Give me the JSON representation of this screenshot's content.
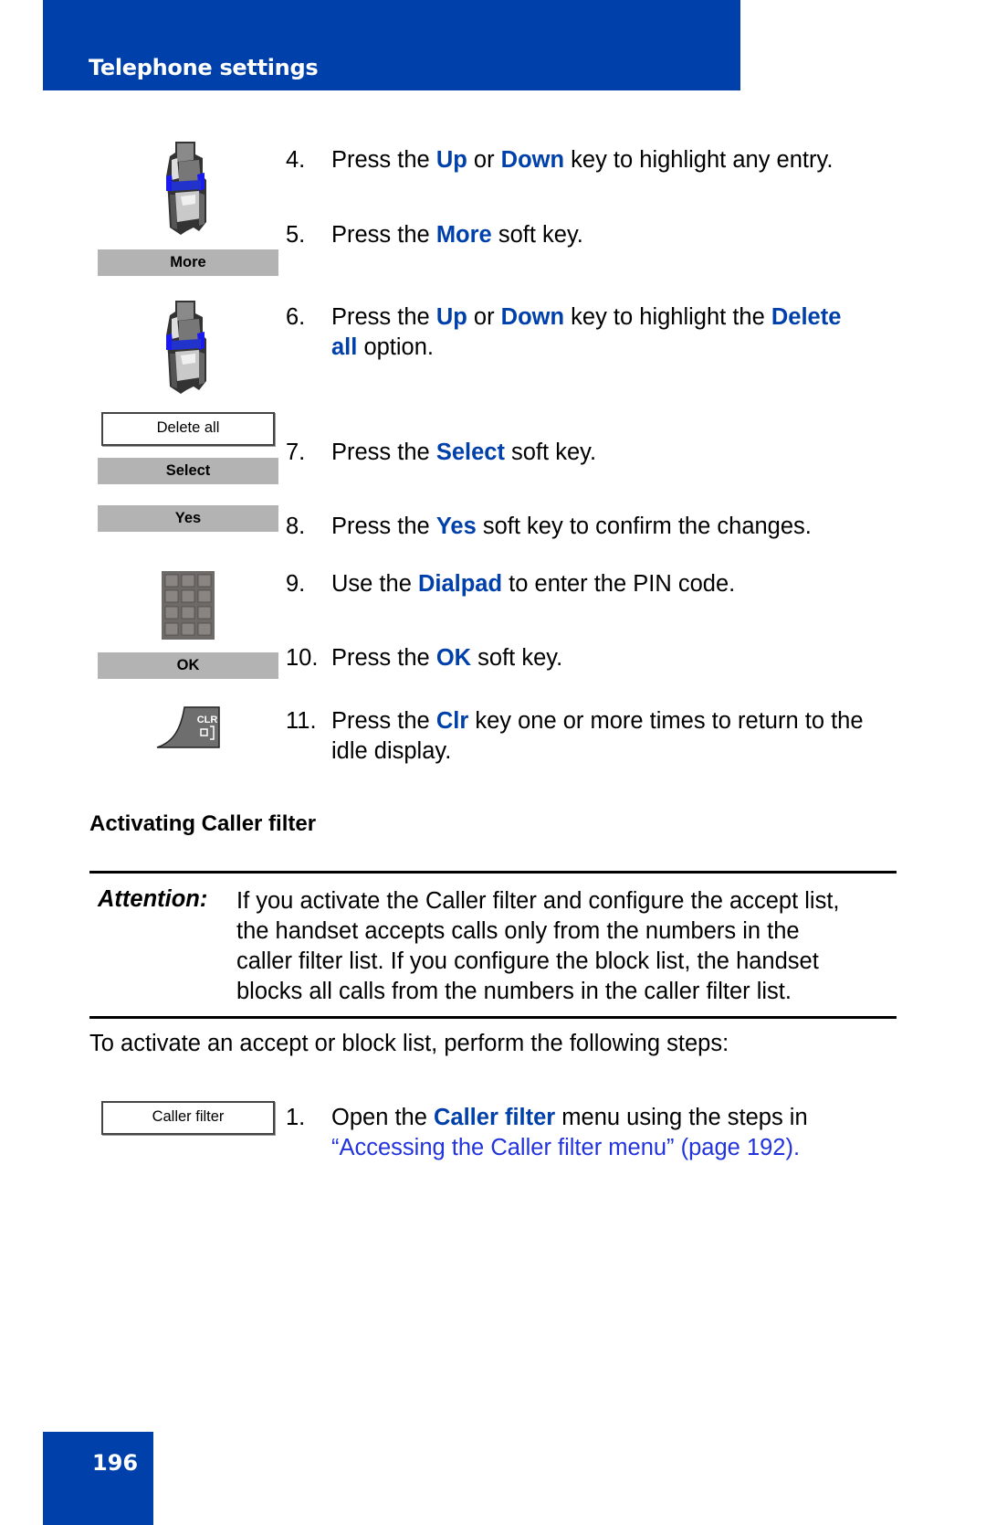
{
  "header": {
    "title": "Telephone settings"
  },
  "footer": {
    "page_number": "196"
  },
  "softkeys": {
    "more": "More",
    "delete_all": "Delete all",
    "select": "Select",
    "yes": "Yes",
    "ok": "OK",
    "caller_filter": "Caller filter"
  },
  "icons": {
    "navigation_key": "navigation-key-icon",
    "dialpad": "dialpad-icon",
    "clear_key": "clr-key-icon",
    "clear_key_label": "CLR"
  },
  "colors": {
    "brand_blue": "#0040AA",
    "softkey_gray": "#B3B3B3",
    "link_blue": "#2233DD"
  },
  "steps_part1": [
    {
      "num": "4.",
      "parts": [
        "Press the ",
        "Up",
        " or ",
        "Down",
        " key to highlight any entry."
      ]
    },
    {
      "num": "5.",
      "parts": [
        "Press the ",
        "More",
        " soft key."
      ]
    },
    {
      "num": "6.",
      "line1": [
        "Press the ",
        "Up",
        " or ",
        "Down",
        " key to highlight the ",
        "Delete"
      ],
      "line2": [
        "all",
        " option."
      ]
    },
    {
      "num": "7.",
      "parts": [
        "Press the ",
        "Select",
        " soft key."
      ]
    },
    {
      "num": "8.",
      "parts": [
        "Press the ",
        "Yes",
        " soft key to confirm the changes."
      ]
    },
    {
      "num": "9.",
      "parts": [
        "Use the ",
        "Dialpad",
        " to enter the PIN code."
      ]
    },
    {
      "num": "10.",
      "parts": [
        "Press the ",
        "OK",
        " soft key."
      ]
    },
    {
      "num": "11.",
      "line1": [
        "Press the ",
        "Clr",
        " key one or more times to return to the"
      ],
      "line2": [
        "idle display."
      ]
    }
  ],
  "section": {
    "heading": "Activating Caller filter",
    "attention_label": "Attention:",
    "attention_lines": [
      "If you activate the Caller filter and configure the accept list,",
      "the handset accepts calls only from the numbers in the",
      "caller filter list. If you configure the block list, the handset",
      "blocks all calls from the numbers in the caller filter list."
    ],
    "intro": "To activate an accept or block list, perform the following steps:"
  },
  "steps_part2": [
    {
      "num": "1.",
      "line1": [
        "Open the ",
        "Caller filter",
        " menu using the steps in"
      ],
      "link": "“Accessing the Caller filter menu” (page 192)",
      "link_end": "."
    }
  ]
}
